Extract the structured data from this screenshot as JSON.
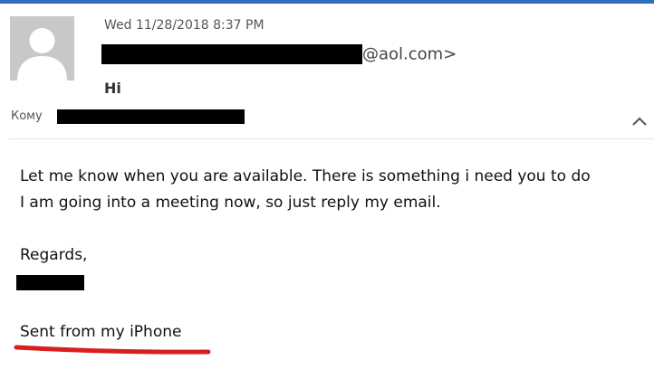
{
  "header": {
    "date": "Wed 11/28/2018 8:37 PM",
    "sender_domain": "@aol.com>",
    "subject": "Hi",
    "to_label": "Кому"
  },
  "icons": {
    "avatar": "person-silhouette-icon",
    "collapse": "chevron-up-icon"
  },
  "colors": {
    "top_border": "#2e6fb7",
    "annotation_underline": "#d81e1e",
    "redaction": "#000000"
  },
  "body": {
    "line1": "Let me know when you are available. There is something i need you to do",
    "line2": "I am going into a meeting now, so just reply my email.",
    "regards": "Regards,",
    "signature_footer": "Sent from my iPhone"
  }
}
